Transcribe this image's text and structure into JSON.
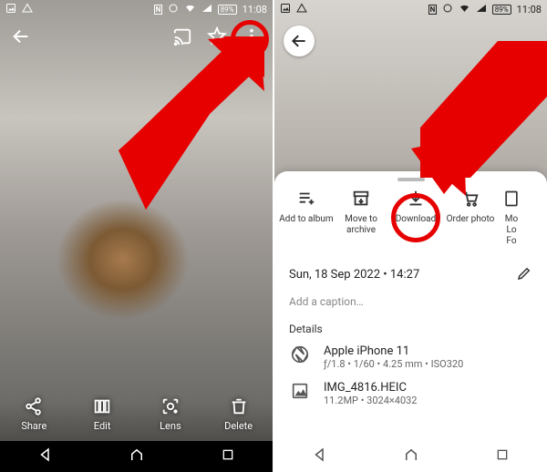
{
  "status": {
    "nfc": "N",
    "battery_percent": "89%",
    "time": "11:08"
  },
  "left": {
    "actions": {
      "share": "Share",
      "edit": "Edit",
      "lens": "Lens",
      "delete": "Delete"
    }
  },
  "right": {
    "sheet_actions": [
      {
        "label": "Add to album"
      },
      {
        "label": "Move to archive"
      },
      {
        "label": "Download"
      },
      {
        "label": "Order photo"
      },
      {
        "label": "Mo\nLo\nFo"
      }
    ],
    "date_line": "Sun, 18 Sep 2022  •  14:27",
    "caption_placeholder": "Add a caption…",
    "details_heading": "Details",
    "camera": {
      "device": "Apple iPhone 11",
      "meta": "ƒ/1.8  •  1/60  •  4.25 mm  •  ISO320"
    },
    "file": {
      "name": "IMG_4816.HEIC",
      "meta": "11.2MP  •  3024×4032"
    }
  }
}
